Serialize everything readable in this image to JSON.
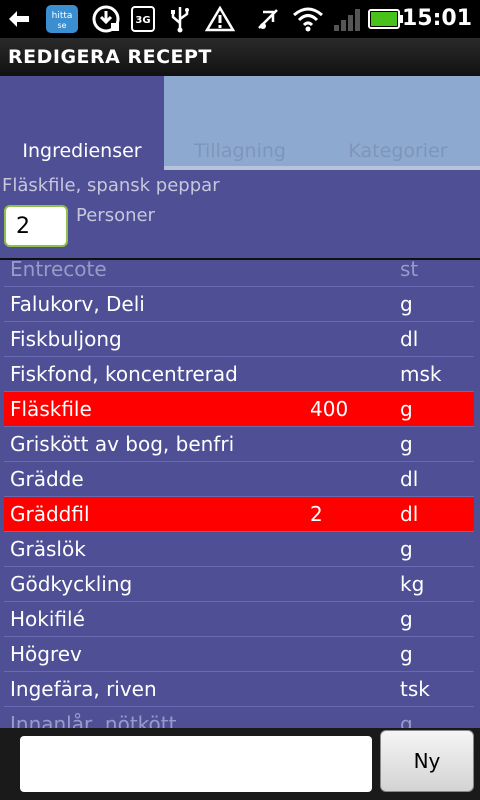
{
  "status_bar": {
    "time": "15:01",
    "icons": [
      "back-icon",
      "hitta-se-icon",
      "download-icon",
      "3g-icon",
      "usb-icon",
      "warning-icon",
      "no-audio-icon",
      "wifi-icon",
      "signal-icon",
      "battery-icon"
    ],
    "hitta_label": "hitta se",
    "network": "3G"
  },
  "title_bar": {
    "title": "REDIGERA RECEPT"
  },
  "tabs": [
    {
      "label": "Ingredienser",
      "active": true
    },
    {
      "label": "Tillagning",
      "active": false
    },
    {
      "label": "Kategorier",
      "active": false
    }
  ],
  "recipe": {
    "name": "Fläskfile, spansk peppar",
    "persons_value": "2",
    "persons_label": "Personer"
  },
  "ingredients": [
    {
      "name": "Entrecote",
      "qty": "",
      "unit": "st",
      "selected": false,
      "partial": true
    },
    {
      "name": "Falukorv, Deli",
      "qty": "",
      "unit": "g",
      "selected": false
    },
    {
      "name": "Fiskbuljong",
      "qty": "",
      "unit": "dl",
      "selected": false
    },
    {
      "name": "Fiskfond, koncentrerad",
      "qty": "",
      "unit": "msk",
      "selected": false
    },
    {
      "name": "Fläskfile",
      "qty": "400",
      "unit": "g",
      "selected": true
    },
    {
      "name": "Griskött av bog, benfri",
      "qty": "",
      "unit": "g",
      "selected": false
    },
    {
      "name": "Grädde",
      "qty": "",
      "unit": "dl",
      "selected": false
    },
    {
      "name": "Gräddfil",
      "qty": "2",
      "unit": "dl",
      "selected": true
    },
    {
      "name": "Gräslök",
      "qty": "",
      "unit": "g",
      "selected": false
    },
    {
      "name": "Gödkyckling",
      "qty": "",
      "unit": "kg",
      "selected": false
    },
    {
      "name": "Hokifilé",
      "qty": "",
      "unit": "g",
      "selected": false
    },
    {
      "name": "Högrev",
      "qty": "",
      "unit": "g",
      "selected": false
    },
    {
      "name": "Ingefära, riven",
      "qty": "",
      "unit": "tsk",
      "selected": false
    },
    {
      "name": "Innanlår, nötkött",
      "qty": "",
      "unit": "g",
      "selected": false,
      "partial": true
    }
  ],
  "bottom": {
    "new_input_value": "",
    "new_button_label": "Ny"
  },
  "colors": {
    "background": "#4f4f96",
    "selected_row": "#ff0000",
    "inactive_tab": "#8ea9cf"
  }
}
